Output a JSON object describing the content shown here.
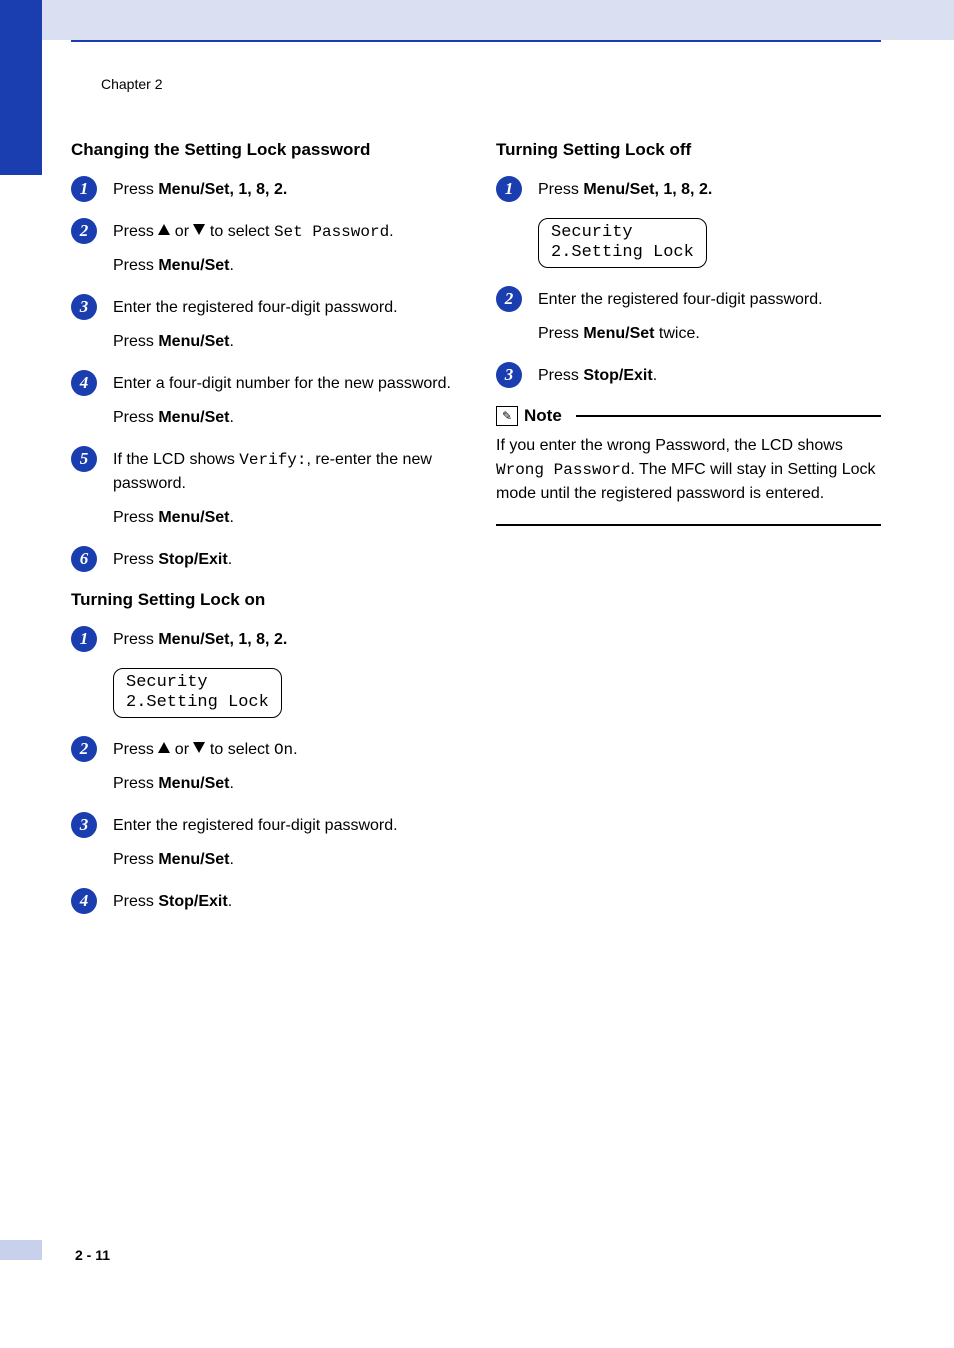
{
  "chapter": "Chapter 2",
  "page_number": "2 - 11",
  "left": {
    "section1": {
      "heading": "Changing the Setting Lock password",
      "steps": {
        "s1": {
          "l1_pre": "Press ",
          "menuset": "Menu/Set",
          "seq": ", 1, 8, 2."
        },
        "s2": {
          "l1_pre": "Press ",
          "l1_mid": " or ",
          "l1_post": " to select ",
          "mono": "Set Password",
          "l1_end": ".",
          "l2_pre": "Press ",
          "menuset": "Menu/Set",
          "l2_end": "."
        },
        "s3": {
          "l1": "Enter the registered four-digit password.",
          "l2_pre": "Press ",
          "menuset": "Menu/Set",
          "l2_end": "."
        },
        "s4": {
          "l1": "Enter a four-digit number for the new password.",
          "l2_pre": "Press ",
          "menuset": "Menu/Set",
          "l2_end": "."
        },
        "s5": {
          "l1_pre": "If the LCD shows ",
          "mono": "Verify:",
          "l1_post": ", re-enter the new password.",
          "l2_pre": "Press ",
          "menuset": "Menu/Set",
          "l2_end": "."
        },
        "s6": {
          "l1_pre": "Press ",
          "stop": "Stop/Exit",
          "l1_end": "."
        }
      }
    },
    "section2": {
      "heading": "Turning Setting Lock on",
      "steps": {
        "s1": {
          "l1_pre": "Press ",
          "menuset": "Menu/Set",
          "seq": ", 1, 8, 2.",
          "lcd": "Security\n2.Setting Lock"
        },
        "s2": {
          "l1_pre": "Press ",
          "l1_mid": " or ",
          "l1_post": " to select ",
          "mono": "On",
          "l1_end": ".",
          "l2_pre": "Press ",
          "menuset": "Menu/Set",
          "l2_end": "."
        },
        "s3": {
          "l1": "Enter the registered four-digit password.",
          "l2_pre": "Press ",
          "menuset": "Menu/Set",
          "l2_end": "."
        },
        "s4": {
          "l1_pre": "Press ",
          "stop": "Stop/Exit",
          "l1_end": "."
        }
      }
    }
  },
  "right": {
    "section1": {
      "heading": "Turning Setting Lock off",
      "steps": {
        "s1": {
          "l1_pre": "Press ",
          "menuset": "Menu/Set",
          "seq": ", 1, 8, 2.",
          "lcd": "Security\n2.Setting Lock"
        },
        "s2": {
          "l1": "Enter the registered four-digit password.",
          "l2_pre": "Press ",
          "menuset": "Menu/Set",
          "l2_end": " twice."
        },
        "s3": {
          "l1_pre": "Press ",
          "stop": "Stop/Exit",
          "l1_end": "."
        }
      }
    },
    "note": {
      "title": "Note",
      "body_pre": "If you enter the wrong Password, the LCD shows ",
      "mono": "Wrong Password",
      "body_post": ". The MFC will stay in Setting Lock mode until the registered password is entered."
    }
  }
}
